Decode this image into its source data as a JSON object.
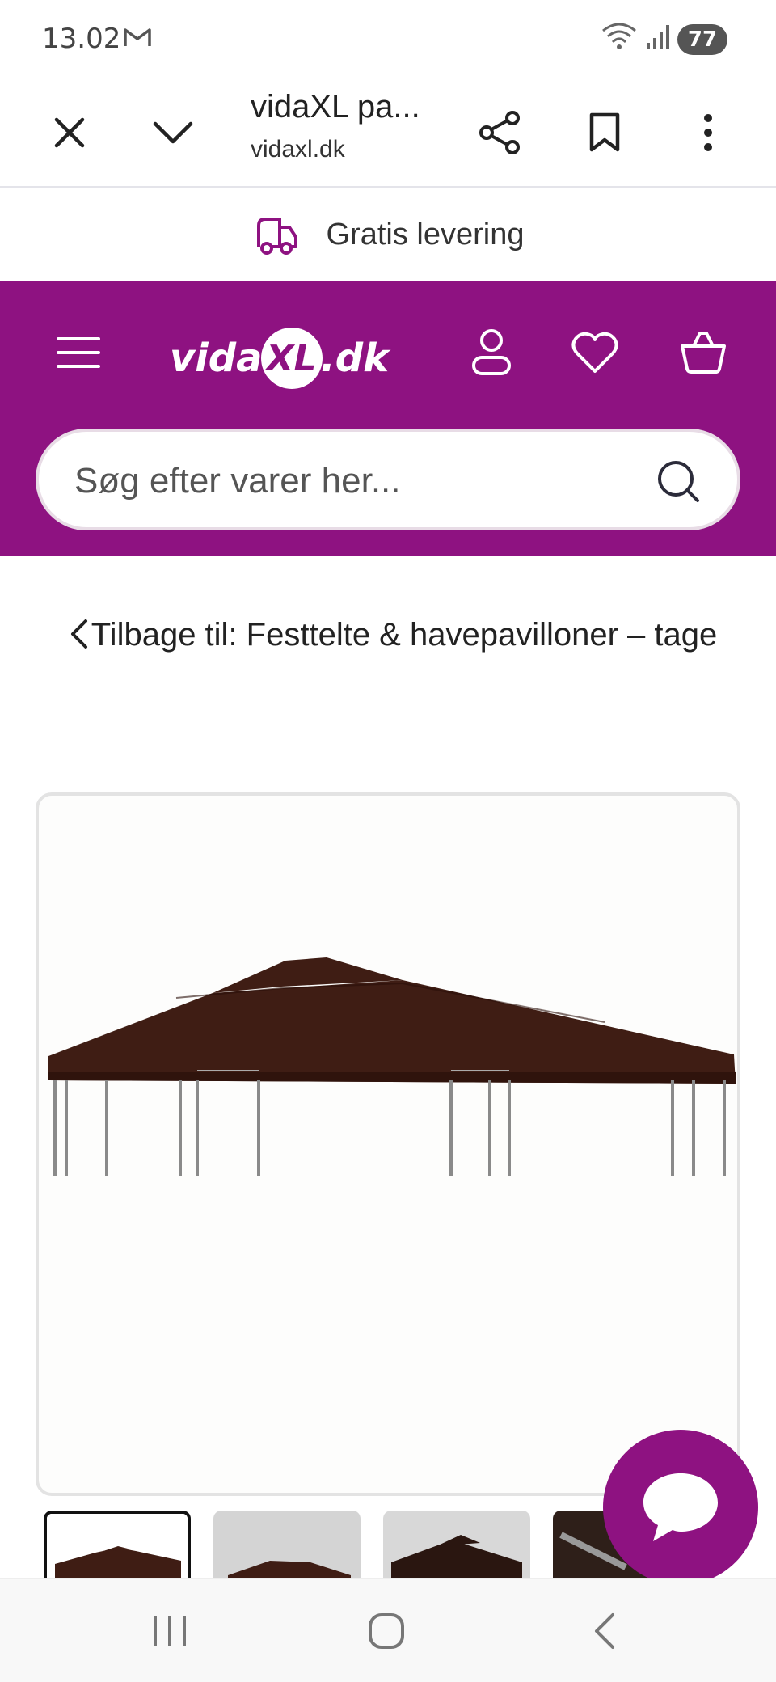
{
  "status": {
    "time": "13.02",
    "battery": "77"
  },
  "browser": {
    "title": "vidaXL pa...",
    "url": "vidaxl.dk"
  },
  "promo": {
    "text": "Gratis levering"
  },
  "header": {
    "brand_prefix": "vida",
    "brand_mark": "XL",
    "brand_suffix": ".dk",
    "brand_color": "#8e1281"
  },
  "search": {
    "placeholder": "Søg efter varer her..."
  },
  "breadcrumb": {
    "back_text": "Tilbage til: Festtelte & havepavilloner – tage"
  },
  "product": {
    "canopy_color": "#3f1d14"
  },
  "thumbnails": {
    "count_visible": 4,
    "active_index": 0
  }
}
